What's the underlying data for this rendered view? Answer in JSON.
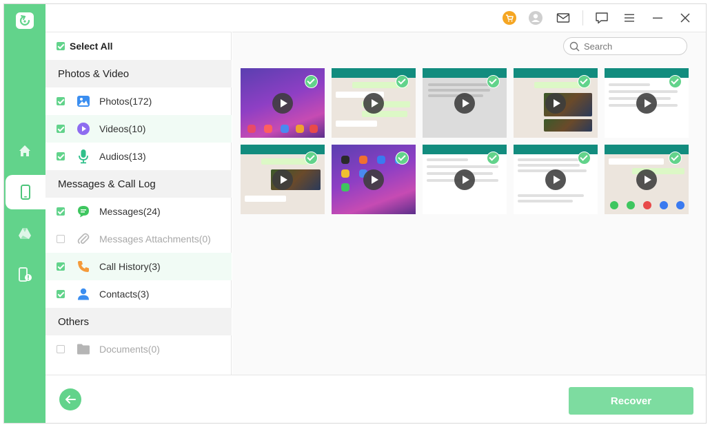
{
  "window": {
    "colors": {
      "accent": "#62d38b",
      "accent_light": "#7ddca0",
      "cart": "#f5a623"
    }
  },
  "rail": {
    "items": [
      {
        "name": "home",
        "icon": "home-icon"
      },
      {
        "name": "device",
        "icon": "phone-icon",
        "active": true
      },
      {
        "name": "drive",
        "icon": "google-drive-icon"
      },
      {
        "name": "broken-device",
        "icon": "phone-warning-icon"
      }
    ]
  },
  "topbar": {
    "icons": [
      "cart-icon",
      "user-icon",
      "mail-icon",
      "feedback-icon",
      "menu-icon",
      "minimize-icon",
      "close-icon"
    ]
  },
  "panel": {
    "select_all": "Select All",
    "sections": {
      "photos_video": "Photos & Video",
      "messages_call": "Messages & Call Log",
      "others": "Others"
    },
    "items": {
      "photos": "Photos(172)",
      "videos": "Videos(10)",
      "audios": "Audios(13)",
      "messages": "Messages(24)",
      "attachments": "Messages Attachments(0)",
      "calls": "Call History(3)",
      "contacts": "Contacts(3)",
      "documents": "Documents(0)"
    }
  },
  "search": {
    "placeholder": "Search"
  },
  "bottom": {
    "recover_label": "Recover"
  }
}
